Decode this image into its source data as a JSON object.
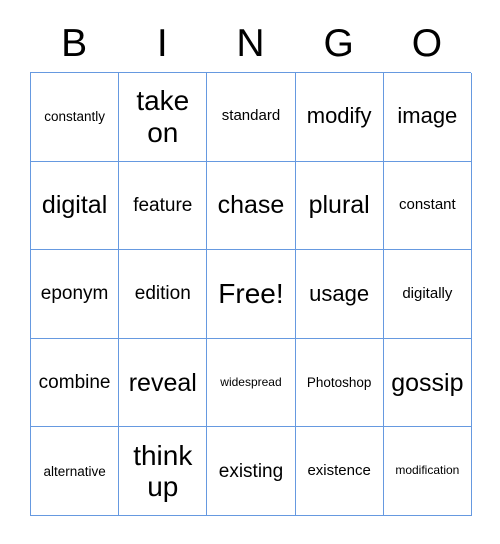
{
  "card": {
    "title_letters": [
      "B",
      "I",
      "N",
      "G",
      "O"
    ],
    "border_color": "#6699e0",
    "background_color": "#ffffff",
    "text_color": "#000000",
    "rows": 5,
    "columns": 5,
    "free_space": "Free!",
    "cells": [
      [
        {
          "label": "constantly",
          "size": "sm"
        },
        {
          "label": "take on",
          "size": "huge"
        },
        {
          "label": "standard",
          "size": "md"
        },
        {
          "label": "modify",
          "size": "xl"
        },
        {
          "label": "image",
          "size": "xl"
        }
      ],
      [
        {
          "label": "digital",
          "size": "xxl"
        },
        {
          "label": "feature",
          "size": "lg"
        },
        {
          "label": "chase",
          "size": "xxl"
        },
        {
          "label": "plural",
          "size": "xxl"
        },
        {
          "label": "constant",
          "size": "md"
        }
      ],
      [
        {
          "label": "eponym",
          "size": "lg"
        },
        {
          "label": "edition",
          "size": "lg"
        },
        {
          "label": "Free!",
          "size": "huge"
        },
        {
          "label": "usage",
          "size": "xl"
        },
        {
          "label": "digitally",
          "size": "md"
        }
      ],
      [
        {
          "label": "combine",
          "size": "lg"
        },
        {
          "label": "reveal",
          "size": "xxl"
        },
        {
          "label": "widespread",
          "size": "xs"
        },
        {
          "label": "Photoshop",
          "size": "sm"
        },
        {
          "label": "gossip",
          "size": "xxl"
        }
      ],
      [
        {
          "label": "alternative",
          "size": "sm"
        },
        {
          "label": "think up",
          "size": "huge"
        },
        {
          "label": "existing",
          "size": "lg"
        },
        {
          "label": "existence",
          "size": "md"
        },
        {
          "label": "modification",
          "size": "xs"
        }
      ]
    ]
  }
}
